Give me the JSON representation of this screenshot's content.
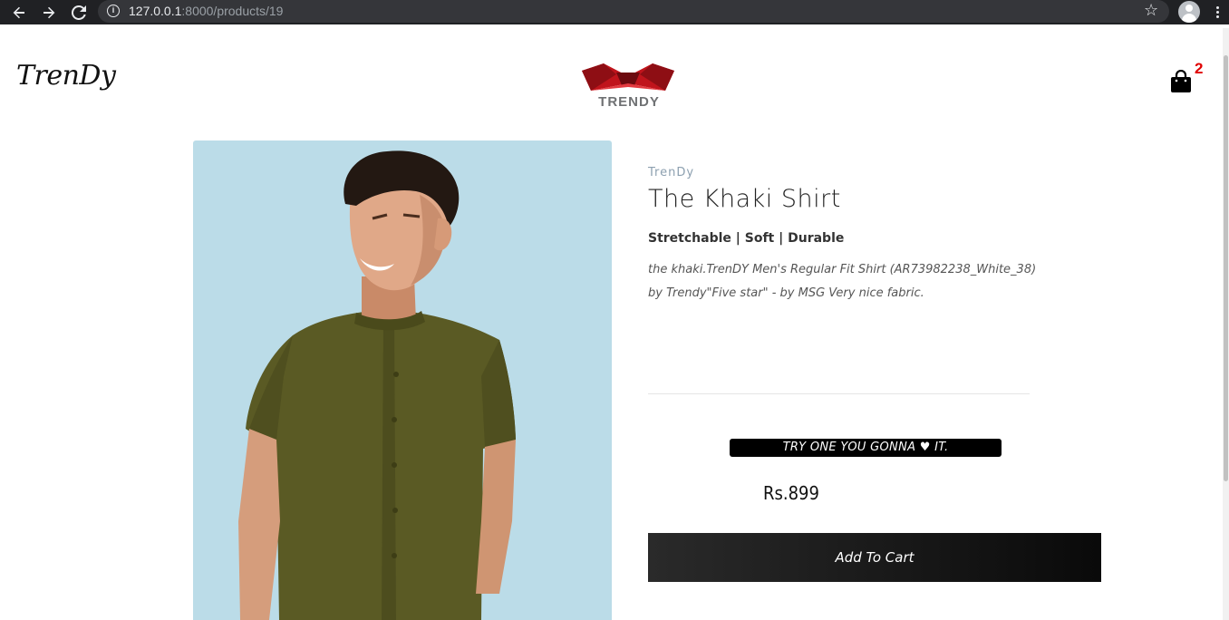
{
  "browser": {
    "url_host": "127.0.0.1",
    "url_rest": ":8000/products/19",
    "icons": [
      "back-arrow-icon",
      "forward-arrow-icon",
      "reload-icon",
      "info-icon",
      "star-icon",
      "profile-icon",
      "menu-icon"
    ]
  },
  "header": {
    "brand": "TrenDy",
    "logo_text": "TRENDY",
    "cart_count": "2",
    "colors": {
      "logo_red": "#c0141c",
      "cart_badge": "#e00000"
    }
  },
  "product": {
    "vendor": "TrenDy",
    "title": "The Khaki Shirt",
    "features": "Stretchable | Soft | Durable",
    "description": "the khaki.TrenDY Men's Regular Fit Shirt (AR73982238_White_38) by Trendy\"Five star\" - by MSG Very nice fabric.",
    "tagline_before": "TRY ONE YOU GONNA ",
    "tagline_heart": "♥",
    "tagline_after": " IT.",
    "price": "Rs.899",
    "add_to_cart": "Add To Cart",
    "image_colors": {
      "background": "#bbdce8",
      "shirt": "#5a5a24"
    }
  }
}
